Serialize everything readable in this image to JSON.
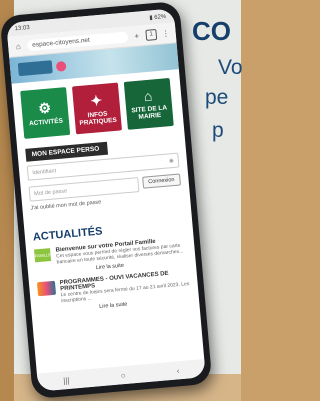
{
  "background": {
    "headline": "CO",
    "lines": [
      "Vo",
      "pe",
      "p"
    ]
  },
  "phone": {
    "status": {
      "time": "13:03",
      "indicators": "▮ 62%"
    },
    "browser": {
      "url": "espace-citoyens.net",
      "tab_count": "1"
    },
    "tiles": [
      {
        "label": "ACTIVITÉS",
        "icon": "gear-icon",
        "color": "#1b8b4a"
      },
      {
        "label": "INFOS PRATIQUES",
        "icon": "bulb-icon",
        "color": "#b11f3a"
      },
      {
        "label": "SITE DE LA MAIRIE",
        "icon": "house-icon",
        "color": "#16663a"
      }
    ],
    "login": {
      "heading": "MON ESPACE PERSO",
      "identifiant_placeholder": "Identifiant",
      "password_placeholder": "Mot de passe",
      "connect_label": "Connexion",
      "forgot": "J'ai oublié mon mot de passe"
    },
    "news": {
      "title": "ACTUALITÉS",
      "items": [
        {
          "title": "Bienvenue sur votre Portail Famille",
          "text": "Cet espace vous permet de régler vos factures par carte bancaire en toute sécurité, réaliser diverses démarches...",
          "thumb": "FAMILLE"
        },
        {
          "title": "PROGRAMMES - OUVI VACANCES DE PRINTEMPS",
          "text": "Le centre de loisirs sera fermé du 17 au 21 avril 2023. Les inscriptions ...",
          "thumb": ""
        }
      ],
      "readmore": "Lire la suite"
    }
  }
}
